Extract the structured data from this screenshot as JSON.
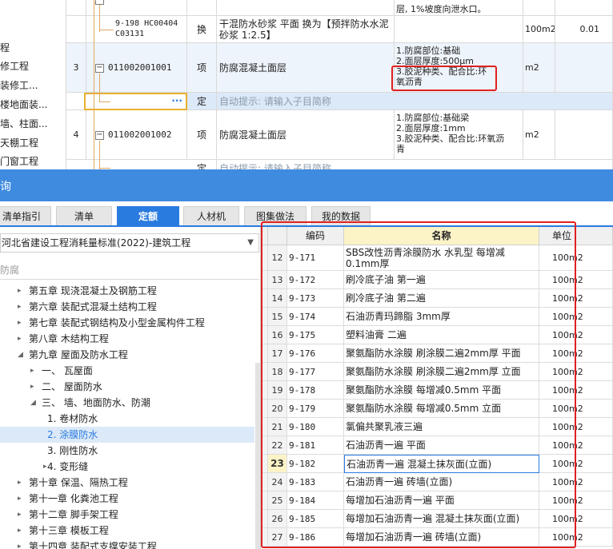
{
  "left_tree": [
    "程",
    "修工程",
    "装修工...",
    "楼地面装...",
    "墙、柱面...",
    "天棚工程",
    "门窗工程"
  ],
  "top_grid": {
    "row0": {
      "desc_top": "层, 1%坡度向泄水口。",
      "remark": ""
    },
    "row_sub": {
      "code": "9-198 HC00404 C03131",
      "type": "换",
      "name": "干混防水砂浆 平面 换为【预拌防水水泥砂浆 1:2.5】",
      "unit": "100m2",
      "qty": "0.01"
    },
    "row3": {
      "num": "3",
      "code": "011002001001",
      "type": "项",
      "name": "防腐混凝土面层",
      "desc_lines": [
        "1.防腐部位:基础",
        "2.面层厚度:500μm",
        "3.胶泥种类、配合比:环",
        "氧沥青"
      ],
      "unit": "m2"
    },
    "row_input": {
      "dots": "···",
      "type": "定",
      "hint": "自动提示: 请输入子目简称"
    },
    "row4": {
      "num": "4",
      "code": "011002001002",
      "type": "项",
      "name": "防腐混凝土面层",
      "desc_lines": [
        "1.防腐部位:基础梁",
        "2.面层厚度:1mm",
        "3.胶泥种类、配合比:环氧沥",
        "青"
      ],
      "unit": "m2"
    },
    "row_last": {
      "type": "定",
      "hint": "自动提示: 请输入子目简称"
    }
  },
  "query_title": "询",
  "tabs": [
    {
      "label": "清单指引",
      "active": false
    },
    {
      "label": "清单",
      "active": false
    },
    {
      "label": "定额",
      "active": true
    },
    {
      "label": "人材机",
      "active": false
    },
    {
      "label": "图集做法",
      "active": false
    },
    {
      "label": "我的数据",
      "active": false
    }
  ],
  "library": {
    "selected": "河北省建设工程消耗量标准(2022)-建筑工程"
  },
  "search": {
    "value": "防腐"
  },
  "chapters": [
    {
      "label": "第五章 现浇混凝土及钢筋工程",
      "arrow": "▸",
      "level": 0
    },
    {
      "label": "第六章 装配式混凝土结构工程",
      "arrow": "▸",
      "level": 0
    },
    {
      "label": "第七章 装配式钢结构及小型金属构件工程",
      "arrow": "▸",
      "level": 0
    },
    {
      "label": "第八章 木结构工程",
      "arrow": "▸",
      "level": 0
    },
    {
      "label": "第九章 屋面及防水工程",
      "arrow": "◢",
      "level": 0
    },
    {
      "label": "一、 瓦屋面",
      "arrow": "▸",
      "level": 1
    },
    {
      "label": "二、 屋面防水",
      "arrow": "▸",
      "level": 1
    },
    {
      "label": "三、 墙、地面防水、防潮",
      "arrow": "◢",
      "level": 1
    },
    {
      "label": "1. 卷材防水",
      "arrow": "",
      "level": 2
    },
    {
      "label": "2. 涂膜防水",
      "arrow": "",
      "level": 2,
      "selected": true
    },
    {
      "label": "3. 刚性防水",
      "arrow": "",
      "level": 2
    },
    {
      "label": "4. 变形缝",
      "arrow": "▸",
      "level": 2
    },
    {
      "label": "第十章 保温、隔热工程",
      "arrow": "▸",
      "level": 0
    },
    {
      "label": "第十一章 化粪池工程",
      "arrow": "▸",
      "level": 0
    },
    {
      "label": "第十二章 脚手架工程",
      "arrow": "▸",
      "level": 0
    },
    {
      "label": "第十三章 模板工程",
      "arrow": "▸",
      "level": 0
    },
    {
      "label": "第十四章 装配式支撑安装工程",
      "arrow": "▸",
      "level": 0
    }
  ],
  "table": {
    "headers": {
      "code": "编码",
      "name": "名称",
      "unit": "单位"
    },
    "rows": [
      {
        "n": "12",
        "code": "9-171",
        "name": "SBS改性沥青涂膜防水 水乳型 每增减0.1mm厚",
        "unit": "100m2"
      },
      {
        "n": "13",
        "code": "9-172",
        "name": "刷冷底子油 第一遍",
        "unit": "100m2"
      },
      {
        "n": "14",
        "code": "9-173",
        "name": "刷冷底子油 第二遍",
        "unit": "100m2"
      },
      {
        "n": "15",
        "code": "9-174",
        "name": "石油沥青玛蹄脂 3mm厚",
        "unit": "100m2"
      },
      {
        "n": "16",
        "code": "9-175",
        "name": "塑料油膏 二遍",
        "unit": "100m2"
      },
      {
        "n": "17",
        "code": "9-176",
        "name": "聚氨酯防水涂膜 刷涂膜二遍2mm厚 平面",
        "unit": "100m2"
      },
      {
        "n": "18",
        "code": "9-177",
        "name": "聚氨酯防水涂膜 刷涂膜二遍2mm厚 立面",
        "unit": "100m2"
      },
      {
        "n": "19",
        "code": "9-178",
        "name": "聚氨酯防水涂膜 每增减0.5mm 平面",
        "unit": "100m2"
      },
      {
        "n": "20",
        "code": "9-179",
        "name": "聚氨酯防水涂膜 每增减0.5mm 立面",
        "unit": "100m2"
      },
      {
        "n": "21",
        "code": "9-180",
        "name": "氯偏共聚乳液三遍",
        "unit": "100m2"
      },
      {
        "n": "22",
        "code": "9-181",
        "name": "石油沥青一遍 平面",
        "unit": "100m2"
      },
      {
        "n": "23",
        "code": "9-182",
        "name": "石油沥青一遍 混凝土抹灰面(立面)",
        "unit": "100m2",
        "current": true
      },
      {
        "n": "24",
        "code": "9-183",
        "name": "石油沥青一遍 砖墙(立面)",
        "unit": "100m2"
      },
      {
        "n": "25",
        "code": "9-184",
        "name": "每增加石油沥青一遍 平面",
        "unit": "100m2"
      },
      {
        "n": "26",
        "code": "9-185",
        "name": "每增加石油沥青一遍 混凝土抹灰面(立面)",
        "unit": "100m2"
      },
      {
        "n": "27",
        "code": "9-186",
        "name": "每增加石油沥青一遍 砖墙(立面)",
        "unit": "100m2"
      }
    ]
  },
  "colors": {
    "accent": "#2a7be0",
    "highlight": "#e02020",
    "selected_row": "#fcf3c6"
  }
}
